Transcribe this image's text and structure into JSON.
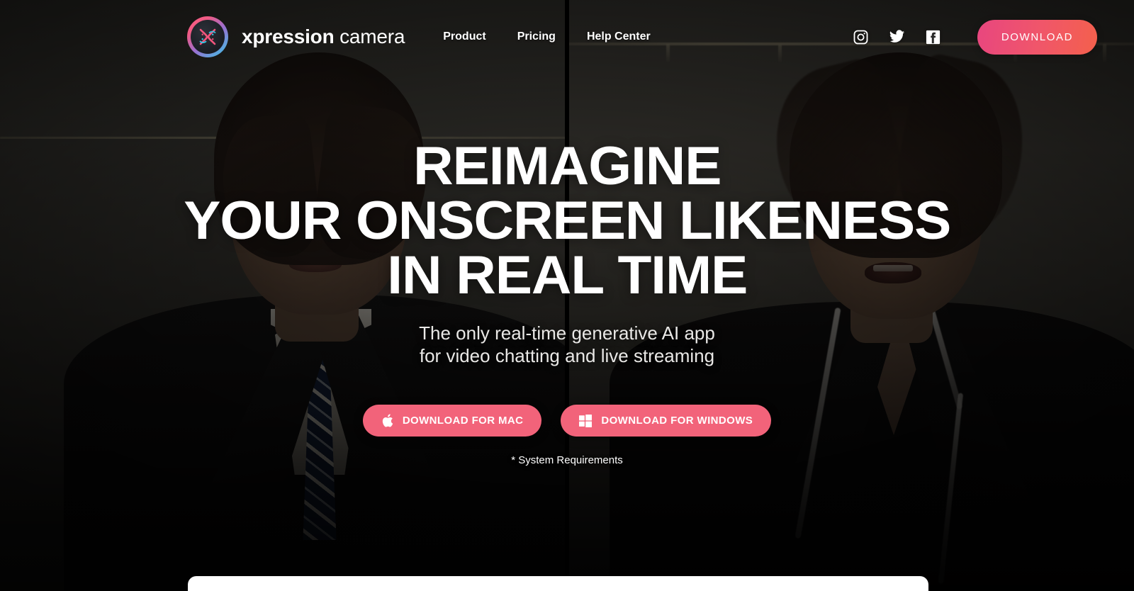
{
  "brand": {
    "name_bold": "xpression",
    "name_light": "camera",
    "logo_icon": "xpression-mask-logo-icon"
  },
  "nav": {
    "links": [
      {
        "label": "Product"
      },
      {
        "label": "Pricing"
      },
      {
        "label": "Help Center"
      }
    ],
    "social": [
      {
        "name": "instagram-icon",
        "label": "Instagram"
      },
      {
        "name": "twitter-icon",
        "label": "Twitter"
      },
      {
        "name": "facebook-icon",
        "label": "Facebook"
      }
    ],
    "download_label": "DOWNLOAD"
  },
  "hero": {
    "headline_line1": "REIMAGINE",
    "headline_line2": "YOUR ONSCREEN LIKENESS",
    "headline_line3": "IN REAL TIME",
    "subhead_line1": "The only real-time generative AI app",
    "subhead_line2": "for video chatting and live streaming",
    "cta_mac_label": "DOWNLOAD FOR MAC",
    "cta_mac_icon": "apple-icon",
    "cta_windows_label": "DOWNLOAD FOR WINDOWS",
    "cta_windows_icon": "windows-icon",
    "system_requirements": "* System Requirements"
  },
  "background": {
    "description": "Split-screen video: same man shown twice — left half in a dark business suit with navy striped tie, right half in black pyjamas with white piping",
    "divider": "vertical-black-split-line"
  },
  "colors": {
    "accent_pink": "#f2637a",
    "gradient_start": "#e8467f",
    "gradient_end": "#f4604c",
    "text_white": "#ffffff",
    "panel_white": "#ffffff"
  }
}
